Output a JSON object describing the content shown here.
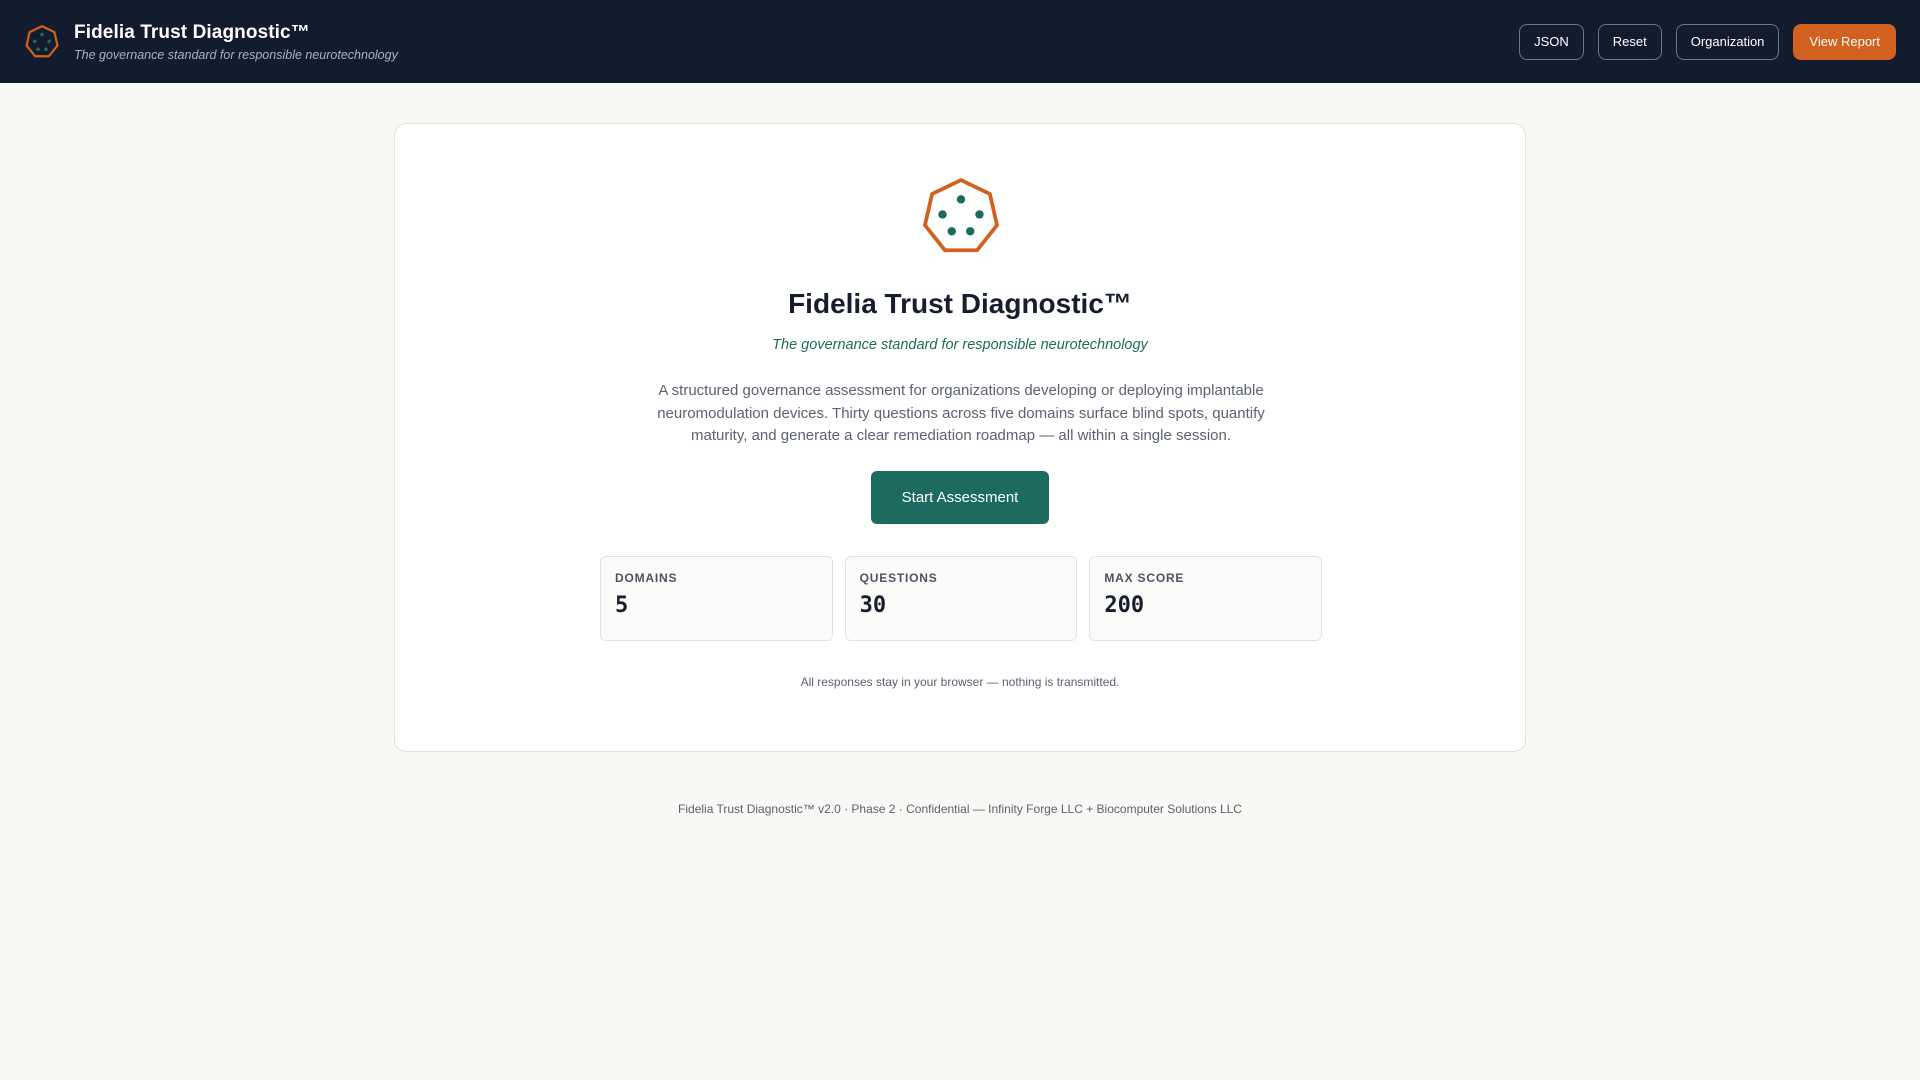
{
  "header": {
    "logo": "heptagon-logo",
    "title": "Fidelia Trust Diagnostic™",
    "subtitle": "The governance standard for responsible neurotechnology",
    "buttons": {
      "json": "JSON",
      "reset": "Reset",
      "organization": "Organization",
      "view_report": "View Report"
    }
  },
  "hero": {
    "logo": "heptagon-logo",
    "title": "Fidelia Trust Diagnostic™",
    "subtitle": "The governance standard for responsible neurotechnology",
    "description": "A structured governance assessment for organizations developing or deploying implantable neuromodulation devices. Thirty questions across five domains surface blind spots, quantify maturity, and generate a clear remediation roadmap — all within a single session.",
    "start_label": "Start Assessment"
  },
  "stats": [
    {
      "label": "DOMAINS",
      "value": "5"
    },
    {
      "label": "QUESTIONS",
      "value": "30"
    },
    {
      "label": "MAX SCORE",
      "value": "200"
    }
  ],
  "privacy_note": "All responses stay in your browser — nothing is transmitted.",
  "footer": "Fidelia Trust Diagnostic™ v2.0 · Phase 2 · Confidential — Infinity Forge LLC + Biocomputer Solutions LLC",
  "colors": {
    "header_bg": "#131c2e",
    "accent_orange": "#d2611f",
    "accent_teal": "#1c6b5e",
    "page_bg": "#f8f8f5"
  }
}
